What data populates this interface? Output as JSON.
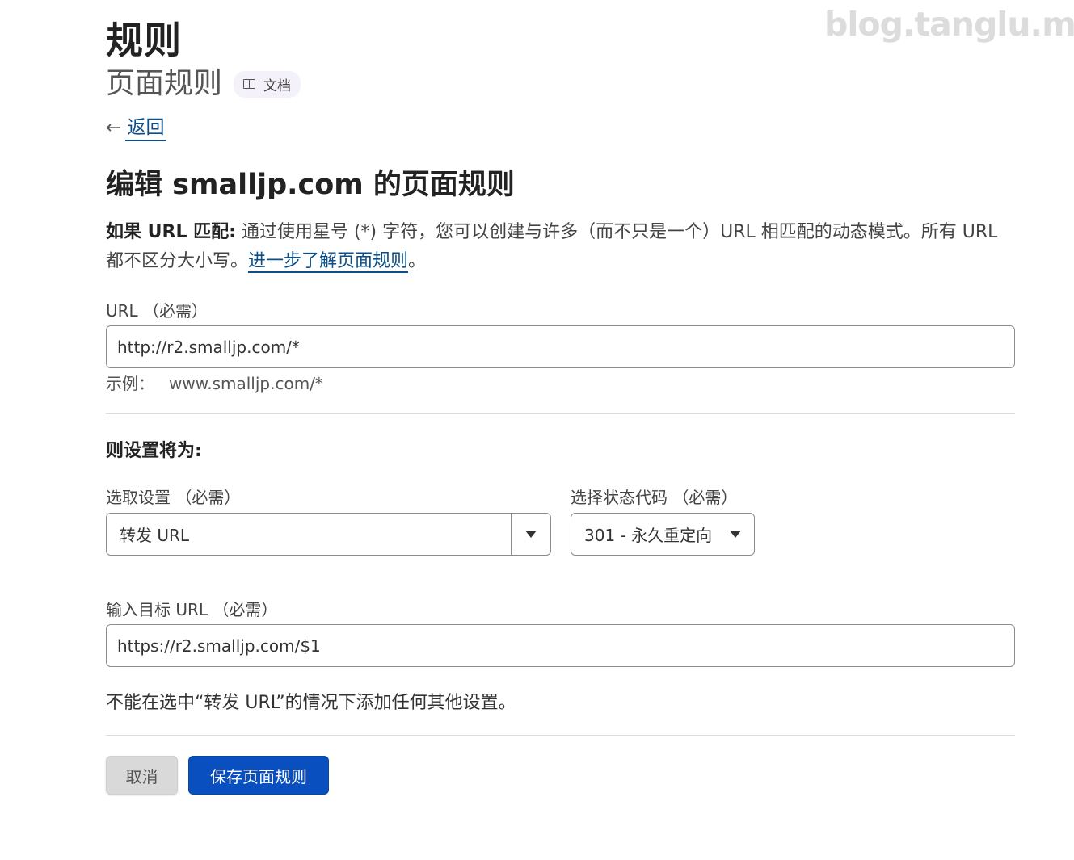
{
  "watermark": "blog.tanglu.me",
  "header": {
    "title": "规则",
    "subtitle": "页面规则",
    "doc_label": "文档"
  },
  "back_label": "返回",
  "page_title": "编辑 smalljp.com 的页面规则",
  "intro": {
    "lead": "如果 URL 匹配:",
    "text": " 通过使用星号 (*) 字符，您可以创建与许多（而不只是一个）URL 相匹配的动态模式。所有 URL 都不区分大小写。",
    "link": "进一步了解页面规则",
    "tail": "。"
  },
  "url_field": {
    "label": "URL （必需）",
    "value": "http://r2.smalljp.com/*",
    "hint_label": "示例：",
    "hint_value": "www.smalljp.com/*"
  },
  "settings_heading": "则设置将为:",
  "setting_select": {
    "label": "选取设置 （必需）",
    "value": "转发 URL"
  },
  "status_select": {
    "label": "选择状态代码 （必需）",
    "value": "301 - 永久重定向"
  },
  "target_field": {
    "label": "输入目标 URL （必需）",
    "value": "https://r2.smalljp.com/$1"
  },
  "note": "不能在选中“转发 URL”的情况下添加任何其他设置。",
  "buttons": {
    "cancel": "取消",
    "save": "保存页面规则"
  }
}
